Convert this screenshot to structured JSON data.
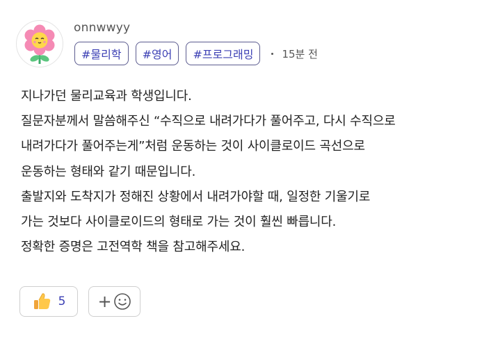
{
  "author": {
    "username": "onnwwyy",
    "avatar_icon": "flower-avatar-icon"
  },
  "tags": [
    "#물리학",
    "#영어",
    "#프로그래밍"
  ],
  "posted_time": "15분 전",
  "answer_lines": [
    "지나가던 물리교육과 학생입니다.",
    "질문자분께서 말씀해주신 “수직으로 내려가다가 풀어주고, 다시 수직으로",
    "내려가다가 풀어주는게”처럼 운동하는 것이 사이클로이드 곡선으로",
    "운동하는 형태와 같기 때문입니다.",
    "출발지와 도착지가 정해진 상황에서 내려가야할 때, 일정한 기울기로",
    "가는 것보다 사이클로이드의 형태로 가는 것이 훨씬 빠릅니다.",
    "정확한 증명은 고전역학 책을 참고해주세요."
  ],
  "reactions": {
    "like_icon": "thumbs-up-icon",
    "like_count": "5",
    "add_icon": "add-emoji-icon"
  },
  "colors": {
    "tag_text": "#3b3fb4",
    "tag_border": "#5b5b8f",
    "body_text": "#222222",
    "meta_text": "#555555"
  }
}
